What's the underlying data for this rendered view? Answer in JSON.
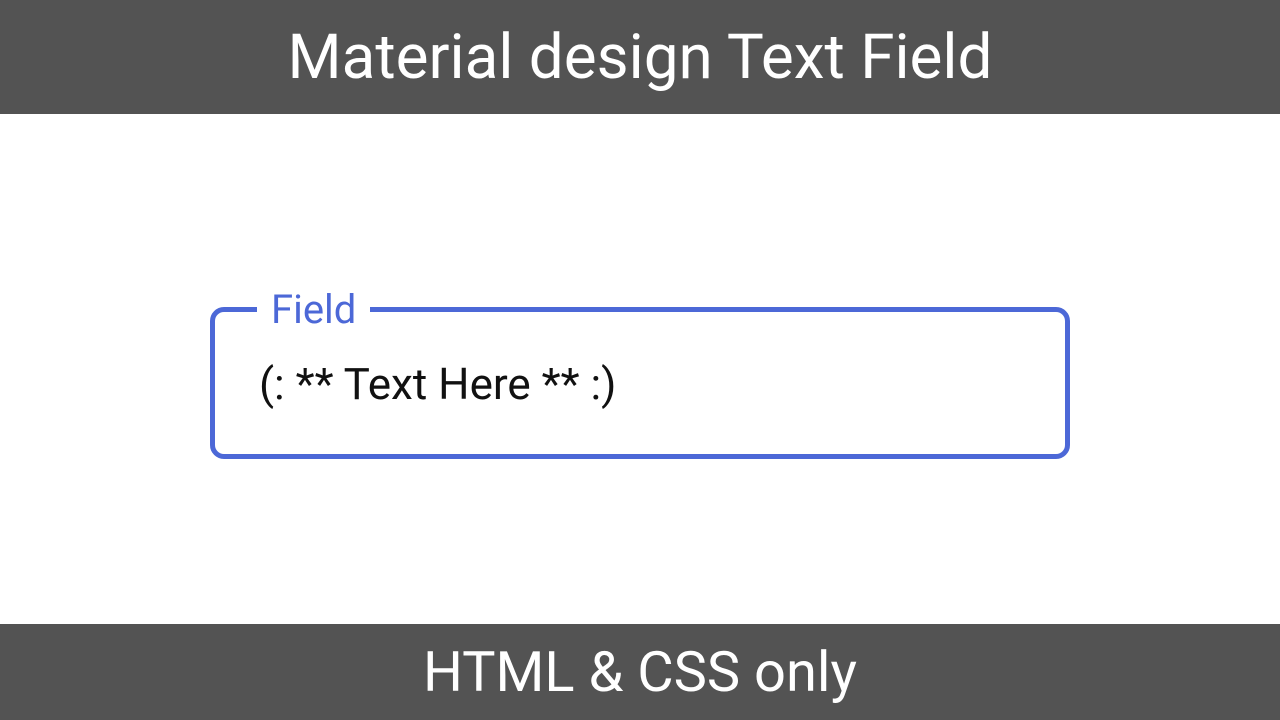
{
  "header": {
    "title": "Material design Text Field"
  },
  "footer": {
    "title": "HTML & CSS only"
  },
  "field": {
    "label": "Field",
    "value": "(: ** Text Here ** :)"
  }
}
